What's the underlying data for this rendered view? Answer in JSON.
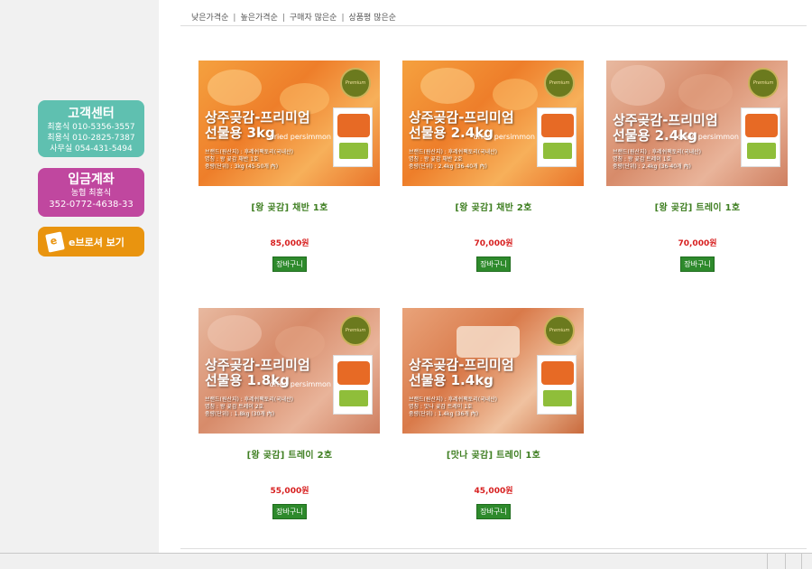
{
  "sidebar": {
    "customer_center": {
      "title": "고객센터",
      "lines": [
        "최홍식 010-5356-3557",
        "최용식 010-2825-7387",
        "사무실 054-431-5494"
      ]
    },
    "bank_account": {
      "title": "입금계좌",
      "holder": "농협 최홍식",
      "number": "352-0772-4638-33"
    },
    "ebrochure_label": "e브로셔 보기"
  },
  "sort_options": [
    "낮은가격순",
    "높은가격순",
    "구매자 많은순",
    "상품평 많은순"
  ],
  "products": [
    {
      "name": "[왕 곶감] 채반 1호",
      "price": "85,000원",
      "cart": "장바구니",
      "img_line1": "상주곶감-프리미엄",
      "img_line2": "선물용 3kg",
      "img_info": [
        "브랜드(원산지) : 후레쉬팩토리(국내산)",
        "명칭 : 왕 곶감 채반 1호",
        "중량(단위) : 3kg (45-50개 內)"
      ]
    },
    {
      "name": "[왕 곶감] 채반 2호",
      "price": "70,000원",
      "cart": "장바구니",
      "img_line1": "상주곶감-프리미엄",
      "img_line2": "선물용 2.4kg",
      "img_info": [
        "브랜드(원산지) : 후레쉬팩토리(국내산)",
        "명칭 : 왕 곶감 채반 2호",
        "중량(단위) : 2.4kg (36-40개 內)"
      ]
    },
    {
      "name": "[왕 곶감] 트레이 1호",
      "price": "70,000원",
      "cart": "장바구니",
      "img_line1": "상주곶감-프리미엄",
      "img_line2": "선물용 2.4kg",
      "img_info": [
        "브랜드(원산지) : 후레쉬팩토리(국내산)",
        "명칭 : 왕 곶감 트레이 1호",
        "중량(단위) : 2.4kg (36-40개 內)"
      ]
    },
    {
      "name": "[왕 곶감] 트레이 2호",
      "price": "55,000원",
      "cart": "장바구니",
      "img_line1": "상주곶감-프리미엄",
      "img_line2": "선물용 1.8kg",
      "img_info": [
        "브랜드(원산지) : 후레쉬팩토리(국내산)",
        "명칭 : 왕 곶감 트레이 2호",
        "중량(단위) : 1.8kg (30개 內)"
      ]
    },
    {
      "name": "[맛나 곶감] 트레이 1호",
      "price": "45,000원",
      "cart": "장바구니",
      "img_line1": "상주곶감-프리미엄",
      "img_line2": "선물용 1.4kg",
      "img_info": [
        "브랜드(원산지) : 후레쉬팩토리(국내산)",
        "명칭 : 맛나 곶감 트레이 1호",
        "중량(단위) : 1.4kg (36개 內)"
      ]
    }
  ],
  "image_badge_text": "Premium",
  "image_dried_text": "dried persimmon",
  "colors": {
    "customer_center_bg": "#5fc0b0",
    "bank_bg": "#c0479f",
    "ebrochure_bg": "#e9940f",
    "product_name": "#3f7f22",
    "price": "#d71f1f",
    "cart_bg": "#2e8a2c"
  }
}
